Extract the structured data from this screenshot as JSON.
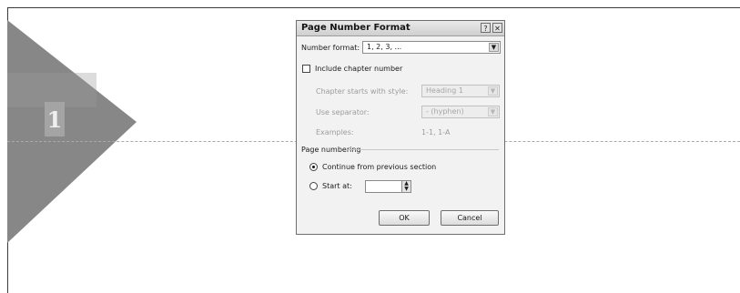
{
  "page": {
    "page_number": "1"
  },
  "dialog": {
    "title": "Page Number Format",
    "help_glyph": "?",
    "close_glyph": "✕",
    "number_format": {
      "label": "Number format:",
      "value": "1, 2, 3, ..."
    },
    "include_chapter": {
      "label": "Include chapter number",
      "checked": false
    },
    "chapter_starts": {
      "label": "Chapter starts with style:",
      "value": "Heading 1"
    },
    "use_separator": {
      "label": "Use separator:",
      "value": "- (hyphen)"
    },
    "examples": {
      "label": "Examples:",
      "value": "1-1, 1-A"
    },
    "page_numbering": {
      "label": "Page numbering",
      "continue_label": "Continue from previous section",
      "start_at_label": "Start at:",
      "start_at_value": "",
      "selected": "continue"
    },
    "buttons": {
      "ok": "OK",
      "cancel": "Cancel"
    }
  },
  "colors": {
    "triangle": "#878787",
    "dialog_bg": "#f2f2f2",
    "disabled_text": "#9c9c9c"
  },
  "icons": {
    "dropdown": "chevron-down-icon",
    "spinner": "spinner-icon",
    "help": "help-icon",
    "close": "close-icon"
  }
}
